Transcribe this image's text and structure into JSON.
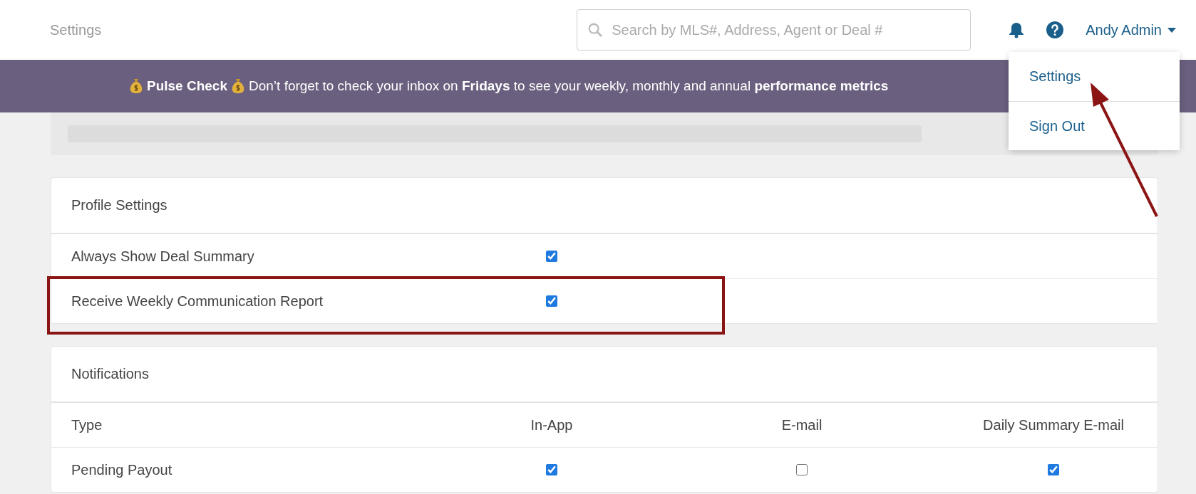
{
  "header": {
    "title": "Settings",
    "search": {
      "placeholder": "Search by MLS#, Address, Agent or Deal #"
    },
    "user": "Andy Admin"
  },
  "user_menu": {
    "items": [
      {
        "label": "Settings",
        "selected": true
      },
      {
        "label": "Sign Out",
        "selected": false
      }
    ]
  },
  "banner": {
    "title": "Pulse Check",
    "message": "Don’t forget to check your inbox on **Fridays** to see your weekly, monthly and annual **performance metrics**"
  },
  "profile_settings": {
    "title": "Profile Settings",
    "rows": [
      {
        "label": "Always Show Deal Summary",
        "checked": true,
        "highlighted": false
      },
      {
        "label": "Receive Weekly Communication Report",
        "checked": true,
        "highlighted": true
      }
    ]
  },
  "notifications": {
    "title": "Notifications",
    "columns": [
      "Type",
      "In-App",
      "E-mail",
      "Daily Summary E-mail"
    ],
    "rows": [
      {
        "type": "Pending Payout",
        "in_app": true,
        "email": false,
        "daily_summary": true
      }
    ]
  }
}
